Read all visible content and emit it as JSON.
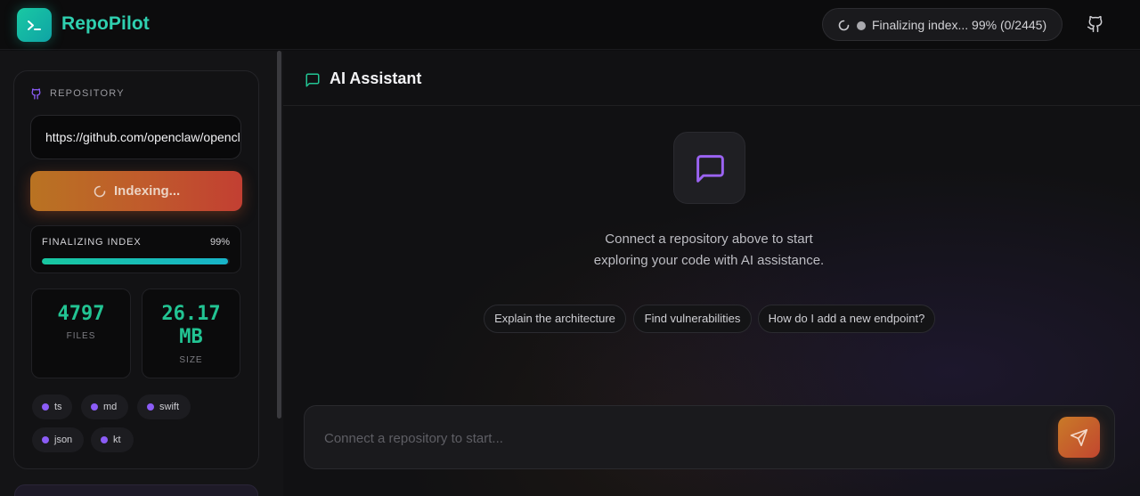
{
  "app": {
    "name": "RepoPilot",
    "status_text": "Finalizing index... 99% (0/2445)"
  },
  "sidebar": {
    "repository_label": "REPOSITORY",
    "repo_url_value": "https://github.com/openclaw/openclaw",
    "index_button_label": "Indexing...",
    "progress": {
      "label": "FINALIZING INDEX",
      "percent_text": "99%",
      "percent": 99
    },
    "stats": {
      "files_value": "4797",
      "files_label": "FILES",
      "size_value_line1": "26.17",
      "size_value_line2": "MB",
      "size_label": "SIZE"
    },
    "languages": [
      "ts",
      "md",
      "swift",
      "json",
      "kt"
    ]
  },
  "main": {
    "title": "AI Assistant",
    "empty_line1": "Connect a repository above to start",
    "empty_line2": "exploring your code with AI assistance.",
    "suggestions": [
      "Explain the architecture",
      "Find vulnerabilities",
      "How do I add a new endpoint?"
    ],
    "chat_placeholder": "Connect a repository to start..."
  },
  "colors": {
    "accent_teal": "#22c493",
    "accent_orange": "#c05a2c",
    "accent_purple": "#8b5cf6"
  },
  "icons": {
    "logo": "terminal-icon",
    "status": "spinner-icon",
    "github": "github-icon",
    "repo": "repo-icon",
    "chat": "message-square-icon",
    "send": "send-icon"
  }
}
